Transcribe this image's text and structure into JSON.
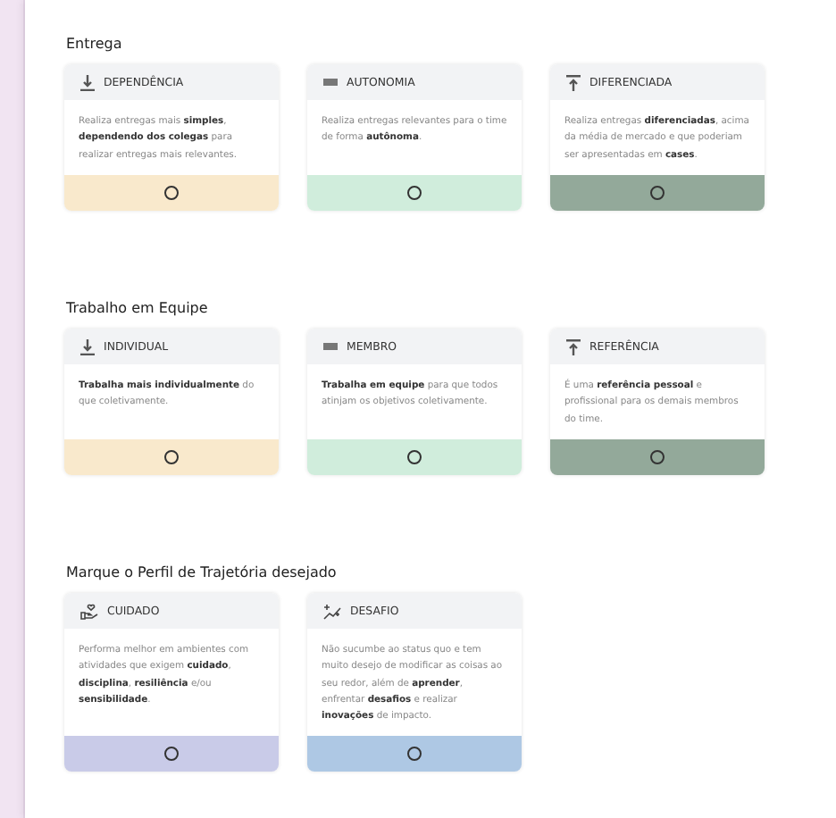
{
  "sections": [
    {
      "title": "Entrega",
      "cards": [
        {
          "kind": "down",
          "label": "DEPENDÊNCIA",
          "text": "Realiza entregas mais **simples**, **dependendo dos colegas** para realizar entregas mais relevantes.",
          "color": "#f9e9cc",
          "selected": false
        },
        {
          "kind": "bar",
          "label": "AUTONOMIA",
          "text": "Realiza entregas relevantes para o time de forma **autônoma**.",
          "color": "#d0eddc",
          "selected": false
        },
        {
          "kind": "up",
          "label": "DIFERENCIADA",
          "text": "Realiza entregas **diferenciadas**, acima da média de mercado e que poderiam ser apresentadas em **cases**.",
          "color": "#93a99a",
          "selected": false
        }
      ]
    },
    {
      "title": "Trabalho em Equipe",
      "cards": [
        {
          "kind": "down",
          "label": "INDIVIDUAL",
          "text": "**Trabalha mais individualmente** do que coletivamente.",
          "color": "#f9e9cc",
          "selected": false
        },
        {
          "kind": "bar",
          "label": "MEMBRO",
          "text": "**Trabalha em equipe** para que todos atinjam os objetivos coletivamente.",
          "color": "#d0eddc",
          "selected": false
        },
        {
          "kind": "up",
          "label": "REFERÊNCIA",
          "text": "É uma **referência pessoal** e profissional para os demais membros do time.",
          "color": "#93a99a",
          "selected": false
        }
      ]
    },
    {
      "title": "Marque o Perfil de Trajetória desejado",
      "cards": [
        {
          "kind": "care",
          "label": "CUIDADO",
          "text": "Performa melhor em ambientes com atividades que exigem **cuidado**, **disciplina**, **resiliência** e/ou **sensibilidade**.",
          "color": "#c9cbe8",
          "selected": false
        },
        {
          "kind": "spark",
          "label": "DESAFIO",
          "text": "Não sucumbe ao status quo e tem muito desejo de modificar as coisas ao seu redor, além de **aprender**, enfrentar **desafios** e realizar **inovações** de impacto.",
          "color": "#aec8e4",
          "selected": false
        }
      ]
    }
  ]
}
